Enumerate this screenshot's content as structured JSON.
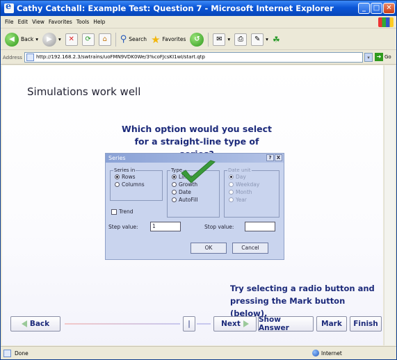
{
  "window": {
    "title": "Cathy Catchall: Example Test: Question 7 - Microsoft Internet Explorer"
  },
  "menu": [
    "File",
    "Edit",
    "View",
    "Favorites",
    "Tools",
    "Help"
  ],
  "toolbar": {
    "back": "Back",
    "search": "Search",
    "favorites": "Favorites"
  },
  "address": {
    "label": "Address",
    "url": "http://192.168.2.3/swtrains/uoFMN9VDK0We/3%coFJcsKI1wI/start.qtp",
    "go": "Go"
  },
  "page": {
    "heading": "Simulations work well",
    "question": "Which option would you select for a straight-line type of series?",
    "hint": "Try selecting a radio button and pressing the Mark button (below)."
  },
  "dialog": {
    "title": "Series",
    "help": "?",
    "close": "X",
    "series_in": {
      "legend": "Series in",
      "options": [
        "Rows",
        "Columns"
      ],
      "selected": "Rows"
    },
    "type": {
      "legend": "Type",
      "options": [
        "Linear",
        "Growth",
        "Date",
        "AutoFill"
      ],
      "selected": "Linear"
    },
    "date_unit": {
      "legend": "Date unit",
      "options": [
        "Day",
        "Weekday",
        "Month",
        "Year"
      ],
      "selected": "Day"
    },
    "trend": "Trend",
    "step_label": "Step value:",
    "step_value": "1",
    "stop_label": "Stop value:",
    "stop_value": "",
    "ok": "OK",
    "cancel": "Cancel"
  },
  "nav": {
    "back": "Back",
    "page": "|",
    "next": "Next",
    "show_answer": "Show Answer",
    "mark": "Mark",
    "finish": "Finish"
  },
  "status": {
    "left": "Done",
    "zone": "Internet"
  },
  "colors": {
    "accent": "#1c2a7a",
    "titlebar": "#0a55d6",
    "check": "#3a9a3a"
  }
}
